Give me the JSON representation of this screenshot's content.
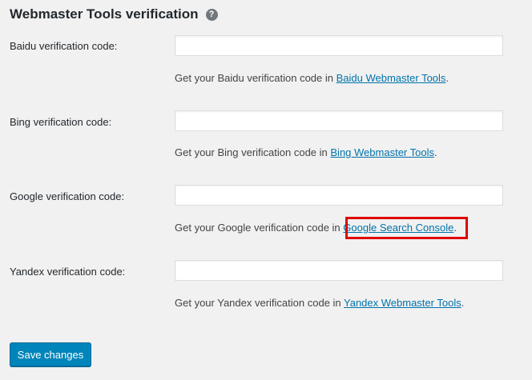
{
  "section": {
    "title": "Webmaster Tools verification",
    "help_icon": "?"
  },
  "fields": [
    {
      "label": "Baidu verification code:",
      "value": "",
      "desc_prefix": "Get your Baidu verification code in ",
      "link_text": "Baidu Webmaster Tools",
      "desc_suffix": "."
    },
    {
      "label": "Bing verification code:",
      "value": "",
      "desc_prefix": "Get your Bing verification code in ",
      "link_text": "Bing Webmaster Tools",
      "desc_suffix": "."
    },
    {
      "label": "Google verification code:",
      "value": "",
      "desc_prefix": "Get your Google verification code in ",
      "link_text": "Google Search Console",
      "desc_suffix": "."
    },
    {
      "label": "Yandex verification code:",
      "value": "",
      "desc_prefix": "Get your Yandex verification code in ",
      "link_text": "Yandex Webmaster Tools",
      "desc_suffix": "."
    }
  ],
  "actions": {
    "save_label": "Save changes"
  },
  "colors": {
    "background": "#f1f1f1",
    "link": "#0073aa",
    "primary_button": "#0085ba",
    "highlight": "#e00000"
  }
}
